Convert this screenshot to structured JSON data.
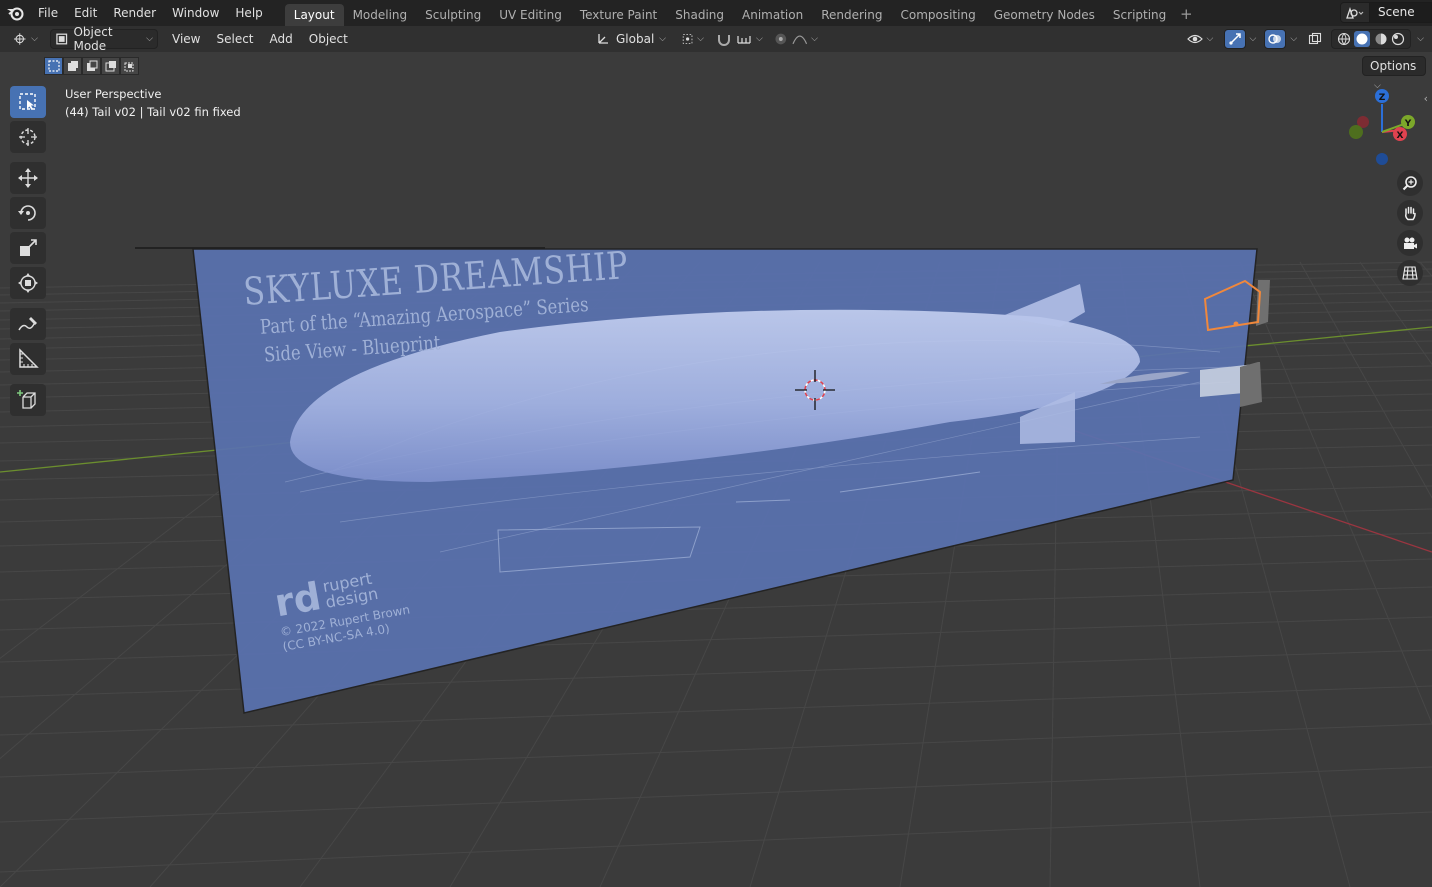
{
  "menu": {
    "items": [
      "File",
      "Edit",
      "Render",
      "Window",
      "Help"
    ]
  },
  "workspaces": {
    "tabs": [
      "Layout",
      "Modeling",
      "Sculpting",
      "UV Editing",
      "Texture Paint",
      "Shading",
      "Animation",
      "Rendering",
      "Compositing",
      "Geometry Nodes",
      "Scripting"
    ],
    "active": "Layout",
    "add_symbol": "+"
  },
  "scene": {
    "name": "Scene"
  },
  "header": {
    "mode": "Object Mode",
    "menus": [
      "View",
      "Select",
      "Add",
      "Object"
    ],
    "transform_orientation": "Global",
    "options_label": "Options"
  },
  "viewport": {
    "perspective": "User Perspective",
    "object_info": "(44) Tail v02 | Tail v02 fin fixed",
    "gizmo_axes": [
      "Z",
      "Y",
      "X"
    ]
  },
  "blueprint": {
    "title": "SKYLUXE DREAMSHIP",
    "subtitle": "Part of the “Amazing Aerospace” Series",
    "view_label": "Side View - Blueprint",
    "brand_line1": "rupert",
    "brand_line2": "design",
    "copyright": "© 2022 Rupert Brown",
    "license": "(CC BY-NC-SA 4.0)"
  },
  "colors": {
    "accent": "#4772b3",
    "blueprint": "#5a72b0",
    "selected_outline": "#f0883c",
    "axis_x": "#e0424f",
    "axis_y": "#7ca82a",
    "axis_z": "#2b6fd8"
  },
  "tools": [
    "select-box-icon",
    "cursor-icon",
    "move-icon",
    "rotate-icon",
    "scale-icon",
    "transform-icon",
    "annotate-icon",
    "measure-icon",
    "add-cube-icon"
  ],
  "nav": [
    "zoom-icon",
    "pan-hand-icon",
    "camera-icon",
    "ortho-grid-icon"
  ]
}
